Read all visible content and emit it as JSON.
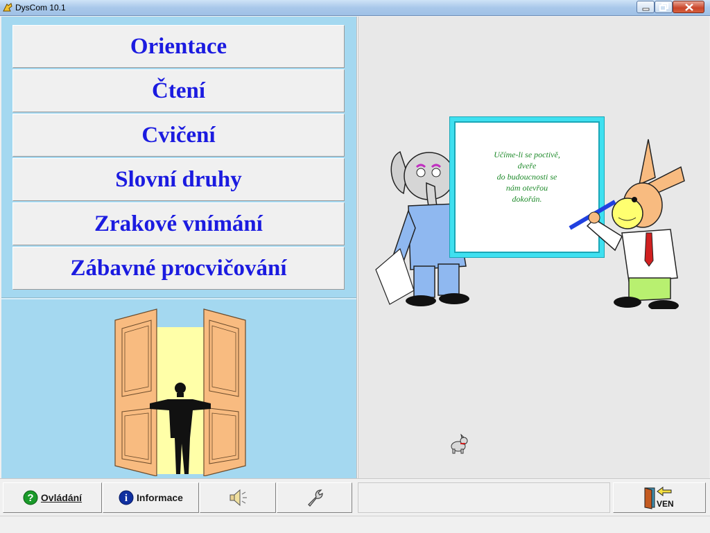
{
  "window": {
    "title": "DysCom 10.1"
  },
  "menu": {
    "items": [
      {
        "label": "Orientace"
      },
      {
        "label": "Čtení"
      },
      {
        "label": "Cvičení"
      },
      {
        "label": "Slovní druhy"
      },
      {
        "label": "Zrakové vnímání"
      },
      {
        "label": "Zábavné procvičování"
      }
    ]
  },
  "board": {
    "lines": [
      "Učíme-li se poctivě,",
      "dveře",
      "do budoucnosti se",
      "nám otevřou",
      "dokořán."
    ]
  },
  "toolbar": {
    "controls_label": "Ovládání",
    "info_label": "Informace",
    "sound_icon": "speaker-icon",
    "settings_icon": "wrench-icon",
    "exit_label": "VEN"
  },
  "colors": {
    "menu_text": "#1b1be0",
    "left_bg": "#a4d8f0",
    "right_bg": "#e8e8e8",
    "board_frame": "#3fe0f0",
    "board_text": "#1e8a2a"
  }
}
